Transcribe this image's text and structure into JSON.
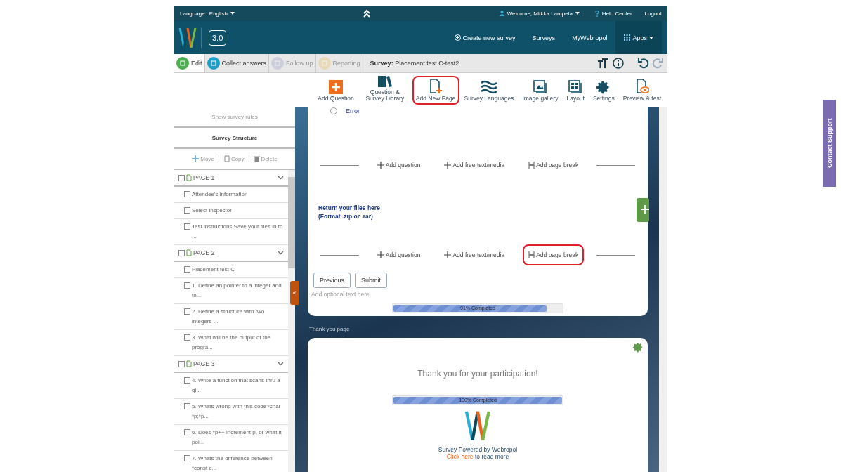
{
  "topbar": {
    "language_label": "Language:",
    "language": "English",
    "welcome": "Welcome, Miikka Lampela",
    "help": "Help Center",
    "logout": "Logout"
  },
  "header": {
    "version": "3.0",
    "nav": [
      {
        "label": "Create new survey",
        "selected": false
      },
      {
        "label": "Surveys",
        "selected": false
      },
      {
        "label": "MyWebropol",
        "selected": false
      },
      {
        "label": "Apps",
        "selected": true
      }
    ]
  },
  "collapse_label": "«",
  "tabs": [
    {
      "label": "Edit",
      "selected": true,
      "disabled": false
    },
    {
      "label": "Collect answers",
      "selected": false,
      "disabled": false
    },
    {
      "label": "Follow up",
      "selected": false,
      "disabled": true
    },
    {
      "label": "Reporting",
      "selected": false,
      "disabled": true
    }
  ],
  "survey": {
    "label": "Survey:",
    "name": "Placement test C-test2"
  },
  "toolbar": [
    {
      "label": "Add Question",
      "highlighted": false
    },
    {
      "label": "Question & Survey Library",
      "highlighted": false
    },
    {
      "label": "Add New Page",
      "highlighted": true
    },
    {
      "label": "Survey Languages",
      "highlighted": false
    },
    {
      "label": "Image gallery",
      "highlighted": false
    },
    {
      "label": "Layout",
      "highlighted": false
    },
    {
      "label": "Settings",
      "highlighted": false
    },
    {
      "label": "Preview & test",
      "highlighted": false
    }
  ],
  "sidebar": {
    "rules": "Show survey rules",
    "title": "Survey Structure",
    "actions": [
      "Move",
      "Copy",
      "Delete"
    ],
    "pages": [
      {
        "label": "PAGE",
        "number": "1",
        "checked": false,
        "items": [
          {
            "text": "Attendee's information",
            "checked": false
          },
          {
            "text": "Select inspector",
            "checked": false
          },
          {
            "text": "Test instructions:Save your files in to ...",
            "checked": false
          }
        ]
      },
      {
        "label": "PAGE",
        "number": "2",
        "checked": false,
        "items": [
          {
            "text": "Placement test C",
            "checked": false
          },
          {
            "text": "1. Define an pointer to a integer and th...",
            "checked": false
          },
          {
            "text": "2. Define a structure with two integers ...",
            "checked": false
          },
          {
            "text": "3. What will be the output of the progra...",
            "checked": false
          }
        ]
      },
      {
        "label": "PAGE",
        "number": "3",
        "checked": false,
        "items": [
          {
            "text": "4. Write a function that scans thru a gi...",
            "checked": false
          },
          {
            "text": "5. Whats wrong with this code?char *p;*p...",
            "checked": false
          },
          {
            "text": "6. Does *p++ increment p, or what it poi...",
            "checked": false
          },
          {
            "text": "7. Whats the difference between *const c...",
            "checked": false
          }
        ]
      }
    ]
  },
  "page_card": {
    "option": {
      "text": "Error",
      "selected": false
    },
    "add_rows": [
      [
        {
          "label": "Add question",
          "highlighted": false
        },
        {
          "label": "Add free text/media",
          "highlighted": false
        },
        {
          "label": "Add page break",
          "highlighted": false
        }
      ],
      [
        {
          "label": "Add question",
          "highlighted": false
        },
        {
          "label": "Add free text/media",
          "highlighted": false
        },
        {
          "label": "Add page break",
          "highlighted": true
        }
      ]
    ],
    "note": [
      "Return your files here",
      "(Format .zip or .rar)"
    ],
    "buttons": [
      "Previous",
      "Submit"
    ],
    "optional_text": "Add optional text here",
    "progress": {
      "label": "91% Completed",
      "level": 0.91
    }
  },
  "thank_you_label": "Thank you page",
  "thank_card": {
    "message": "Thank you for your participation!",
    "progress": {
      "label": "100% Completed",
      "level": 1
    },
    "powered": "Survey Powered by Webropol",
    "link": "Click here",
    "link_rest": "to read more"
  },
  "contact_support": "Contact Support"
}
